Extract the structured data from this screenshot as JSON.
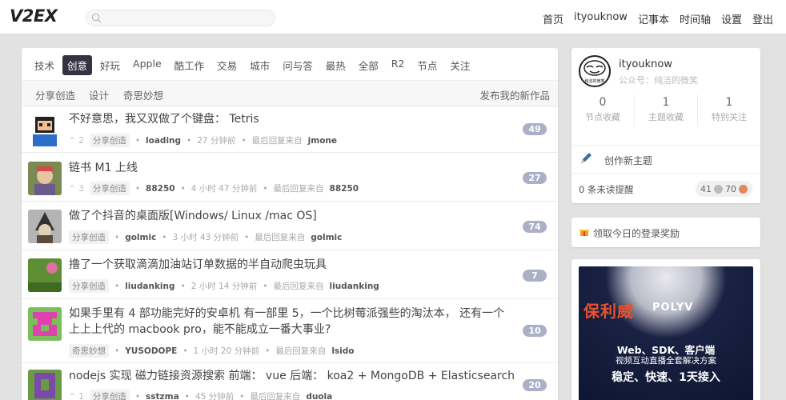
{
  "header": {
    "logo": "V2EX",
    "nav": [
      "首页",
      "ityouknow",
      "记事本",
      "时间轴",
      "设置",
      "登出"
    ]
  },
  "tabs": [
    "技术",
    "创意",
    "好玩",
    "Apple",
    "酷工作",
    "交易",
    "城市",
    "问与答",
    "最热",
    "全部",
    "R2",
    "节点",
    "关注"
  ],
  "active_tab": "创意",
  "subtabs": [
    "分享创造",
    "设计",
    "奇思妙想"
  ],
  "create_link": "发布我的新作品",
  "topics": [
    {
      "title": "不好意思，我又双做了个键盘： Tetris",
      "votes": "2",
      "node": "分享创造",
      "user": "loading",
      "time": "27 分钟前",
      "last_label": "最后回复来自",
      "last_user": "jmone",
      "replies": "49"
    },
    {
      "title": "链书 M1 上线",
      "votes": "3",
      "node": "分享创造",
      "user": "88250",
      "time": "4 小时 47 分钟前",
      "last_label": "最后回复来自",
      "last_user": "88250",
      "replies": "27"
    },
    {
      "title": "做了个抖音的桌面版[Windows/ Linux /mac OS]",
      "votes": "",
      "node": "分享创造",
      "user": "golmic",
      "time": "3 小时 43 分钟前",
      "last_label": "最后回复来自",
      "last_user": "golmic",
      "replies": "74"
    },
    {
      "title": "撸了一个获取滴滴加油站订单数据的半自动爬虫玩具",
      "votes": "",
      "node": "分享创造",
      "user": "liudanking",
      "time": "2 小时 14 分钟前",
      "last_label": "最后回复来自",
      "last_user": "liudanking",
      "replies": "7"
    },
    {
      "title": "如果手里有 4 部功能完好的安卓机 有一部里 5，一个比树莓派强些的淘汰本， 还有一个",
      "title2": "上上上代的 macbook pro，能不能成立一番大事业?",
      "votes": "",
      "node": "奇思妙想",
      "user": "YUSODOPE",
      "time": "1 小时 20 分钟前",
      "last_label": "最后回复来自",
      "last_user": "lsido",
      "replies": "10"
    },
    {
      "title": "nodejs 实现 磁力链接资源搜索 前端： vue 后端： koa2 + MongoDB + Elasticsearch",
      "votes": "1",
      "node": "分享创造",
      "user": "sstzma",
      "time": "45 分钟前",
      "last_label": "最后回复来自",
      "last_user": "duola",
      "replies": "20"
    }
  ],
  "sidebar": {
    "username": "ityouknow",
    "subtitle": "公众号：纯洁的微笑",
    "avatar_caption": "纯洁的微笑",
    "stats": [
      {
        "n": "0",
        "label": "节点收藏"
      },
      {
        "n": "1",
        "label": "主题收藏"
      },
      {
        "n": "1",
        "label": "特别关注"
      }
    ],
    "new_topic": "创作新主题",
    "unread": "0 条未读提醒",
    "silver": "41",
    "bronze": "70",
    "reward": "领取今日的登录奖励"
  },
  "ad": {
    "brand": "保利威",
    "brand_en": "POLYV",
    "line1": "Web、SDK、客户端",
    "line2": "视频互动直播全套解决方案",
    "line3": "稳定、快速、1天接入"
  },
  "colors": {
    "accent_tab": "#334",
    "reply_badge": "#aab0c6",
    "ad_brand": "#e8522c"
  }
}
